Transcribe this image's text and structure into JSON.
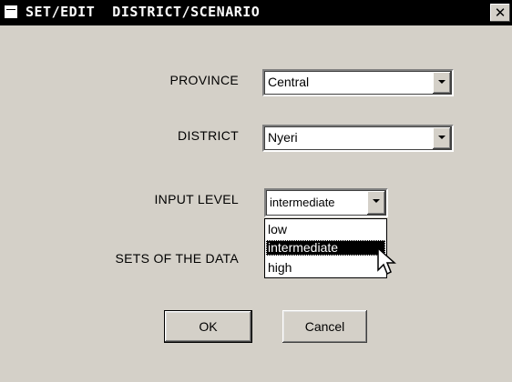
{
  "window": {
    "title": "SET/EDIT  DISTRICT/SCENARIO",
    "close_glyph": "✕"
  },
  "fields": {
    "province": {
      "label": "PROVINCE",
      "value": "Central"
    },
    "district": {
      "label": "DISTRICT",
      "value": "Nyeri"
    },
    "input_level": {
      "label": "INPUT LEVEL",
      "value": "intermediate",
      "options": [
        "low",
        "intermediate",
        "high"
      ],
      "highlighted": "intermediate"
    },
    "sets_of_data": {
      "label": "SETS OF THE DATA"
    }
  },
  "buttons": {
    "ok": "OK",
    "cancel": "Cancel"
  },
  "icons": {
    "window_icon": "window-menu-icon",
    "dropdown_arrow": "chevron-down-icon",
    "cursor": "mouse-pointer-icon"
  },
  "colors": {
    "face": "#d4d0c8",
    "titlebar": "#000000",
    "highlight": "#000000"
  }
}
